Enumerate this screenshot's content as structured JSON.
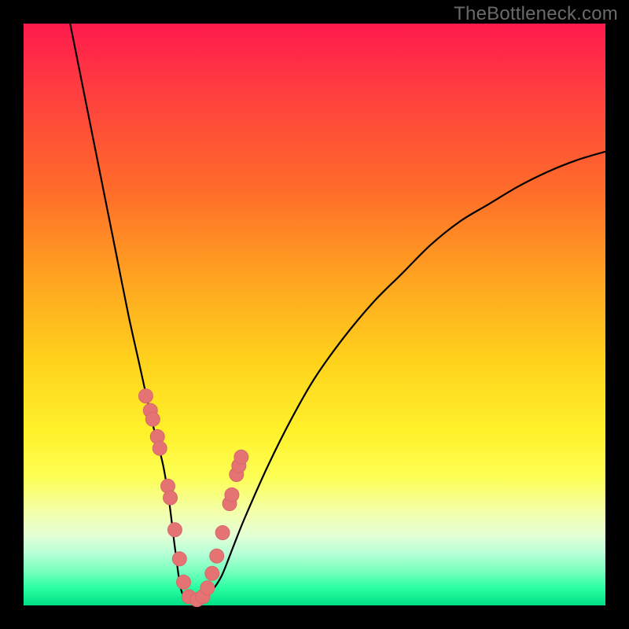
{
  "watermark": "TheBottleneck.com",
  "colors": {
    "frame": "#000000",
    "curve": "#000000",
    "marker_fill": "#e57373",
    "marker_stroke": "#d46a6a"
  },
  "chart_data": {
    "type": "line",
    "title": "",
    "xlabel": "",
    "ylabel": "",
    "xlim": [
      0,
      100
    ],
    "ylim": [
      0,
      100
    ],
    "series": [
      {
        "name": "bottleneck-curve",
        "x": [
          8,
          10,
          12,
          14,
          16,
          18,
          20,
          22,
          23,
          24,
          25,
          26,
          27,
          28,
          29,
          30,
          31,
          32,
          34,
          36,
          38,
          42,
          46,
          50,
          55,
          60,
          65,
          70,
          75,
          80,
          85,
          90,
          95,
          100
        ],
        "y": [
          100,
          90,
          80,
          70,
          60,
          50,
          41,
          32,
          28,
          24,
          18,
          10,
          3,
          1,
          0.5,
          0.5,
          1,
          2,
          5,
          10,
          15,
          24,
          32,
          39,
          46,
          52,
          57,
          62,
          66,
          69,
          72,
          74.5,
          76.5,
          78
        ]
      }
    ],
    "markers": {
      "name": "sample-points",
      "x": [
        21.0,
        21.8,
        22.2,
        23.0,
        23.4,
        24.8,
        25.2,
        26.0,
        26.8,
        27.5,
        28.4,
        29.8,
        30.8,
        31.6,
        32.4,
        33.2,
        34.2,
        35.4,
        35.8,
        36.6,
        37.0,
        37.4
      ],
      "y": [
        36,
        33.5,
        32,
        29,
        27,
        20.5,
        18.5,
        13,
        8,
        4,
        1.5,
        1,
        1.5,
        3,
        5.5,
        8.5,
        12.5,
        17.5,
        19,
        22.5,
        24,
        25.5
      ]
    }
  }
}
